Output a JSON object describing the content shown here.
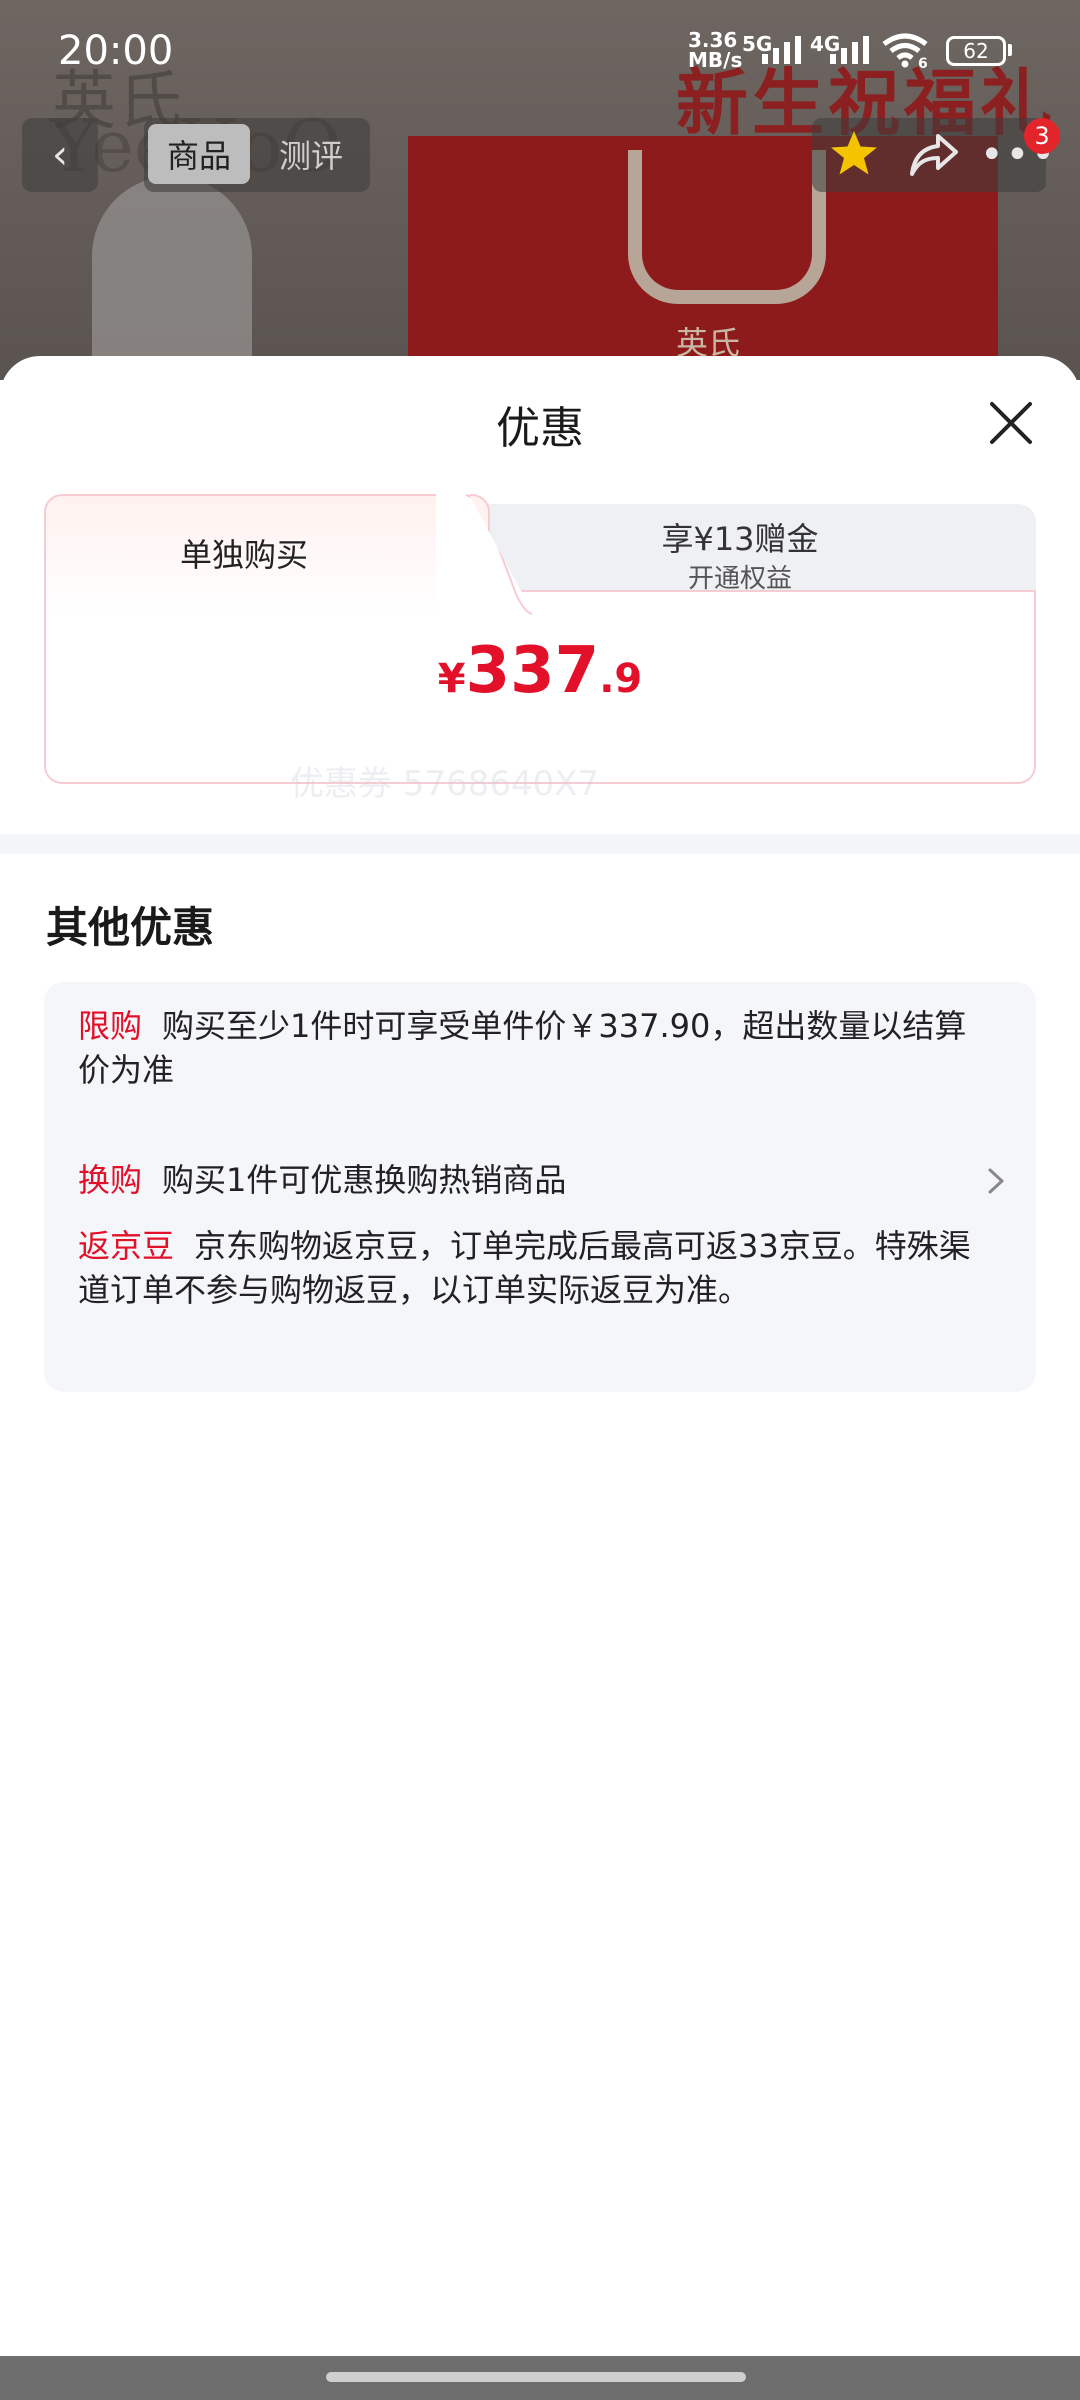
{
  "status_bar": {
    "time": "20:00",
    "net_speed": "3.36\nMB/s",
    "net_speed_top": "3.36",
    "net_speed_bottom": "MB/s",
    "sim1": "5G",
    "sim2": "4G",
    "wifi_label": "6",
    "battery": "62"
  },
  "background": {
    "brand_cn": "英氏",
    "brand_en": "YeeHoO",
    "promo": "新生祝福礼",
    "bag_logo": "英氏"
  },
  "nav": {
    "back_icon": "chevron-left-icon",
    "tabs": [
      "商品",
      "测评"
    ],
    "active_tab": "商品",
    "cart_badge": "3"
  },
  "sheet": {
    "title": "优惠",
    "tabs": {
      "left_label": "单独购买",
      "right_line1": "享¥13赠金",
      "right_line2": "开通权益"
    },
    "price": {
      "symbol": "¥",
      "integer": "337",
      "decimal": ".9"
    },
    "other_title": "其他优惠",
    "watermark": "优惠券 5768640X7",
    "offers": [
      {
        "tag": "限购",
        "text": "购买至少1件时可享受单件价￥337.90，超出数量以结算价为准"
      },
      {
        "tag": "换购",
        "text": "购买1件可优惠换购热销商品"
      },
      {
        "tag": "返京豆",
        "text": "京东购物返京豆，订单完成后最高可返33京豆。特殊渠道订单不参与购物返豆，以订单实际返豆为准。"
      }
    ]
  },
  "colors": {
    "accent_red": "#e3102a",
    "tab_border": "#f6cbd3",
    "panel_bg": "#f5f6fa"
  }
}
